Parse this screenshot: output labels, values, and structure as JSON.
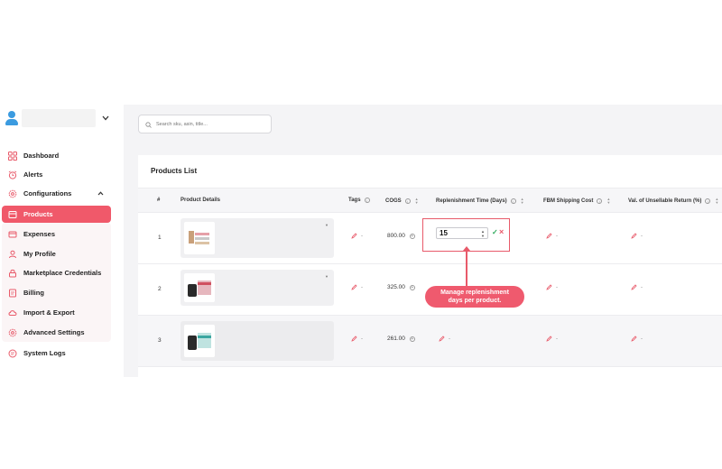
{
  "sidebar": {
    "items": [
      {
        "label": "Dashboard",
        "icon": "dashboard-grid-icon"
      },
      {
        "label": "Alerts",
        "icon": "alarm-icon"
      },
      {
        "label": "Configurations",
        "icon": "gear-icon"
      },
      {
        "label": "Products",
        "icon": "box-icon"
      },
      {
        "label": "Expenses",
        "icon": "wallet-icon"
      },
      {
        "label": "My Profile",
        "icon": "user-icon"
      },
      {
        "label": "Marketplace Credentials",
        "icon": "lock-icon"
      },
      {
        "label": "Billing",
        "icon": "billing-icon"
      },
      {
        "label": "Import & Export",
        "icon": "cloud-icon"
      },
      {
        "label": "Advanced Settings",
        "icon": "settings-icon"
      },
      {
        "label": "System Logs",
        "icon": "logs-icon"
      }
    ]
  },
  "search": {
    "placeholder": "Search sku, asin, title..."
  },
  "products_list": {
    "title": "Products List",
    "columns": [
      "#",
      "Product Details",
      "Tags",
      "COGS",
      "Replenishment Time (Days)",
      "FBM Shipping Cost",
      "Val. of Unsellable Return (%)"
    ],
    "rows": [
      {
        "num": "1",
        "cogs": "800.00",
        "replenishment_value": "15",
        "tags": "-",
        "fbm": "-",
        "unsellable": "-"
      },
      {
        "num": "2",
        "cogs": "325.00",
        "replenishment": "-",
        "tags": "-",
        "fbm": "-",
        "unsellable": "-"
      },
      {
        "num": "3",
        "cogs": "261.00",
        "replenishment": "-",
        "tags": "-",
        "fbm": "-",
        "unsellable": "-"
      }
    ]
  },
  "tooltip": {
    "line1": "Manage replenishment",
    "line2": "days per product."
  },
  "colors": {
    "accent": "#f0596a",
    "confirm": "#2eaa5b",
    "avatar": "#3b9be0"
  }
}
